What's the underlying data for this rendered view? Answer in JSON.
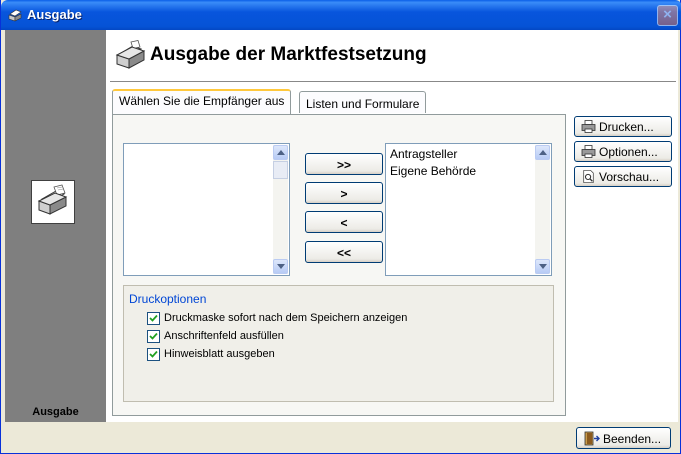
{
  "window": {
    "title": "Ausgabe",
    "close_label": "×"
  },
  "sidebar": {
    "label": "Ausgabe",
    "icon": "printer-icon"
  },
  "header": {
    "title": "Ausgabe der Marktfestsetzung",
    "icon": "printer-icon"
  },
  "tabs": [
    {
      "label": "Wählen Sie die Empfänger aus",
      "active": true
    },
    {
      "label": "Listen und Formulare",
      "active": false
    }
  ],
  "available_list": {
    "items": []
  },
  "selected_list": {
    "items": [
      "Antragsteller",
      "Eigene Behörde"
    ]
  },
  "move_buttons": {
    "add_all": ">>",
    "add": ">",
    "remove": "<",
    "remove_all": "<<"
  },
  "print_options": {
    "title": "Druckoptionen",
    "options": [
      {
        "label": "Druckmaske sofort nach dem Speichern anzeigen",
        "checked": true
      },
      {
        "label": "Anschriftenfeld ausfüllen",
        "checked": true
      },
      {
        "label": "Hinweisblatt ausgeben",
        "checked": true
      }
    ]
  },
  "actions": {
    "print": "Drucken...",
    "options": "Optionen...",
    "preview": "Vorschau..."
  },
  "footer": {
    "exit": "Beenden..."
  },
  "colors": {
    "titlebar": "#0553D6",
    "sidebar": "#7F7F7F",
    "accent_tab": "#FFC83C",
    "group_title": "#0046D5"
  }
}
